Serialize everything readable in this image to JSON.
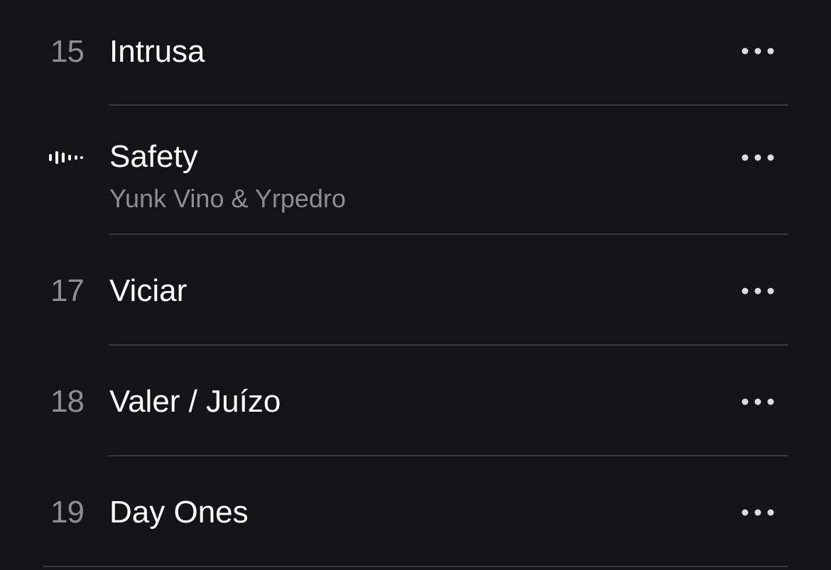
{
  "tracks": [
    {
      "number": "15",
      "title": "Intrusa",
      "artist": "",
      "playing": false
    },
    {
      "number": "",
      "title": "Safety",
      "artist": "Yunk Vino & Yrpedro",
      "playing": true
    },
    {
      "number": "17",
      "title": "Viciar",
      "artist": "",
      "playing": false
    },
    {
      "number": "18",
      "title": "Valer / Juízo",
      "artist": "",
      "playing": false
    },
    {
      "number": "19",
      "title": "Day Ones",
      "artist": "",
      "playing": false
    }
  ],
  "icons": {
    "more": "ellipsis-icon",
    "now_playing": "now-playing-waveform-icon"
  },
  "colors": {
    "background": "#141417",
    "primary_text": "#ffffff",
    "secondary_text": "#8d8d92",
    "divider": "#38383c",
    "more_icon": "#dcdcdf"
  }
}
